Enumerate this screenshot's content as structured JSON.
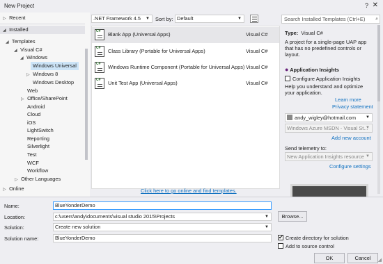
{
  "window": {
    "title": "New Project",
    "help": "?",
    "close": "✕"
  },
  "left": {
    "recent": "Recent",
    "installed": "Installed",
    "templates": "Templates",
    "tree": [
      {
        "label": "Visual C#",
        "arrow": "◢"
      },
      {
        "label": "Windows",
        "arrow": "◢"
      },
      {
        "label": "Windows Universal",
        "arrow": ""
      },
      {
        "label": "Windows 8",
        "arrow": "▷"
      },
      {
        "label": "Windows Desktop",
        "arrow": ""
      },
      {
        "label": "Web",
        "arrow": ""
      },
      {
        "label": "Office/SharePoint",
        "arrow": "▷"
      },
      {
        "label": "Android",
        "arrow": ""
      },
      {
        "label": "Cloud",
        "arrow": ""
      },
      {
        "label": "iOS",
        "arrow": ""
      },
      {
        "label": "LightSwitch",
        "arrow": ""
      },
      {
        "label": "Reporting",
        "arrow": ""
      },
      {
        "label": "Silverlight",
        "arrow": ""
      },
      {
        "label": "Test",
        "arrow": ""
      },
      {
        "label": "WCF",
        "arrow": ""
      },
      {
        "label": "Workflow",
        "arrow": ""
      },
      {
        "label": "Other Languages",
        "arrow": "▷"
      }
    ],
    "online": "Online"
  },
  "middle": {
    "framework": ".NET Framework 4.5",
    "sort_label": "Sort by:",
    "sort_value": "Default",
    "templates": [
      {
        "name": "Blank App (Universal Apps)",
        "lang": "Visual C#"
      },
      {
        "name": "Class Library (Portable for Universal Apps)",
        "lang": "Visual C#"
      },
      {
        "name": "Windows Runtime Component (Portable for Universal Apps)",
        "lang": "Visual C#"
      },
      {
        "name": "Unit Test App (Universal Apps)",
        "lang": "Visual C#"
      }
    ],
    "online_link": "Click here to go online and find templates."
  },
  "right": {
    "search_placeholder": "Search Installed Templates (Ctrl+E)",
    "type_label": "Type:",
    "type_value": "Visual C#",
    "desc1": "A project for a single-page UAP app",
    "desc2": "that has no predefined controls or",
    "desc3": "layout.",
    "ai_title": "Application Insights",
    "ai_checkbox": "Configure Application Insights",
    "ai_desc1": "Help you understand and optimize",
    "ai_desc2": "your application.",
    "learn_more": "Learn more",
    "privacy": "Privacy statement",
    "account": "andy_wigley@hotmail.com",
    "subscription": "Windows Azure MSDN - Visual St...",
    "add_account": "Add new account",
    "telemetry_label": "Send telemetry to:",
    "telemetry_value": "New Application Insights resource",
    "configure": "Configure settings"
  },
  "bottom": {
    "name_label": "Name:",
    "name_value": "BlueYonderDemo",
    "location_label": "Location:",
    "location_value": "c:\\users\\andy\\documents\\visual studio 2015\\Projects",
    "browse": "Browse...",
    "solution_label": "Solution:",
    "solution_value": "Create new solution",
    "solution_name_label": "Solution name:",
    "solution_name_value": "BlueYonderDemo",
    "create_dir": "Create directory for solution",
    "add_source": "Add to source control",
    "ok": "OK",
    "cancel": "Cancel"
  }
}
